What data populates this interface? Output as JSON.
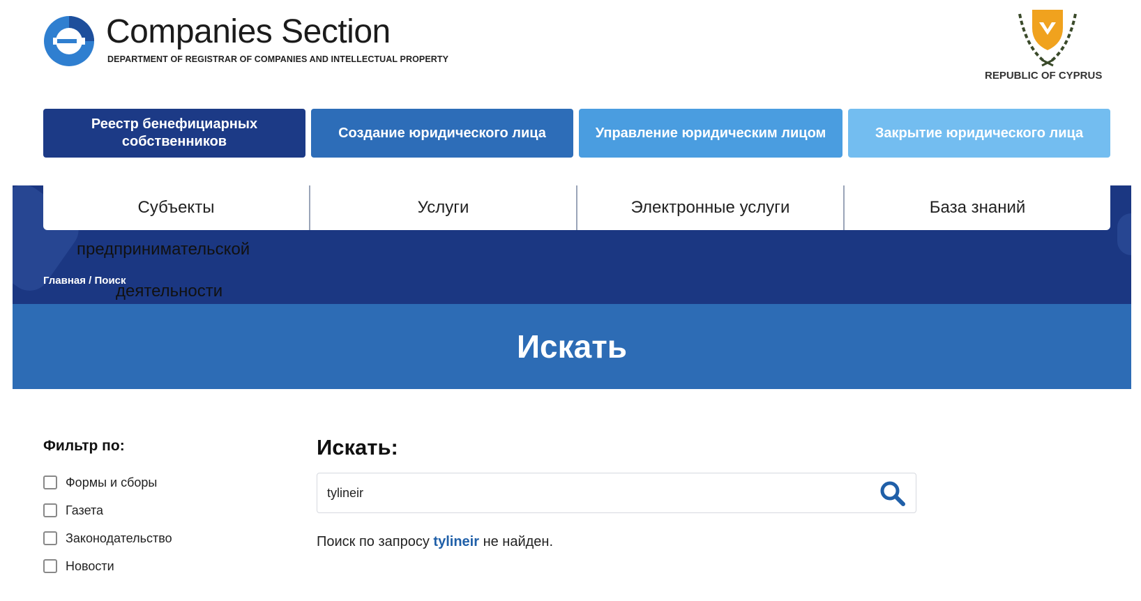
{
  "header": {
    "brand_title": "Companies Section",
    "brand_subtitle": "DEPARTMENT OF REGISTRAR OF COMPANIES AND INTELLECTUAL PROPERTY",
    "country": "REPUBLIC OF CYPRUS"
  },
  "top_buttons": [
    {
      "label": "Реестр бенефициарных собственников"
    },
    {
      "label": "Создание юридического лица"
    },
    {
      "label": "Управление юридическим лицом"
    },
    {
      "label": "Закрытие юридического лица"
    }
  ],
  "nav": [
    {
      "label": "Субъекты"
    },
    {
      "label": "Услуги"
    },
    {
      "label": "Электронные услуги"
    },
    {
      "label": "База знаний"
    }
  ],
  "overflow_text": {
    "line1": "предпринимательской",
    "line2": "деятельности"
  },
  "breadcrumb": "Главная / Поиск",
  "page_title": "Искать",
  "filters": {
    "title": "Фильтр по:",
    "items": [
      {
        "label": "Формы и сборы"
      },
      {
        "label": "Газета"
      },
      {
        "label": "Законодательство"
      },
      {
        "label": "Новости"
      },
      {
        "label": "..."
      }
    ]
  },
  "search": {
    "label": "Искать:",
    "value": "tylineir",
    "result_prefix": "Поиск по запросу",
    "result_query": "tylineir",
    "result_suffix": "не найден."
  },
  "colors": {
    "dark_blue": "#1c3a86",
    "mid_blue": "#2d6db8",
    "light_blue": "#4a9de0",
    "lighter_blue": "#73bdf0",
    "band_blue": "#1b3782",
    "title_blue": "#2d6cb5",
    "accent_orange": "#f0a21e"
  }
}
